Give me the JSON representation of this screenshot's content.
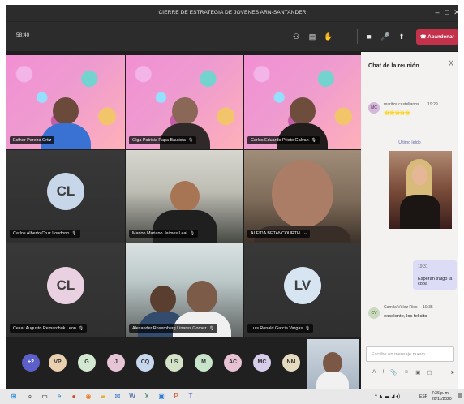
{
  "window": {
    "title": "CIERRE DE ESTRATEGIA DE JOVENES ARN-SANTANDER",
    "minimize": "–",
    "maximize": "□",
    "close": "✕"
  },
  "toolbar": {
    "timer": "58:40",
    "leave_label": "Abandonar",
    "icons": [
      "participants-icon",
      "chat-icon",
      "raise-hand-icon",
      "more-icon",
      "camera-icon",
      "microphone-icon",
      "share-icon",
      "phone-hangup-icon"
    ]
  },
  "grid": {
    "tiles": [
      {
        "name": "Esther Pereira Ortiz",
        "mic": ""
      },
      {
        "name": "Olga Patricia Papa Bautista",
        "mic": "🎙"
      },
      {
        "name": "Carlos Eduardo Prieto Galvan",
        "mic": "🎙"
      },
      {
        "name": "Carlos Alberto Cruz Londono",
        "mic": "🎙",
        "initials": "CL"
      },
      {
        "name": "Marlon Mariano Jaimes Leal",
        "mic": "🎙"
      },
      {
        "name": "ALEIDA BETANCOURTH",
        "mic": "···"
      },
      {
        "name": "Cesar Augusto Remarchuk Leon",
        "mic": "🎙",
        "initials": "CL"
      },
      {
        "name": "Alexander Rosemberg Linares Gomez",
        "mic": "🎙"
      },
      {
        "name": "Luis Ronald Garcia Vargas",
        "mic": "🎙",
        "initials": "LV"
      }
    ]
  },
  "attendees": [
    {
      "initials": "+2",
      "color": "#5b5fc7"
    },
    {
      "initials": "VP",
      "color": "#e9d0b0"
    },
    {
      "initials": "G",
      "color": "#d3e8d0"
    },
    {
      "initials": "J",
      "color": "#e5c5d6"
    },
    {
      "initials": "CQ",
      "color": "#c7d7ee"
    },
    {
      "initials": "LS",
      "color": "#d4e2c8"
    },
    {
      "initials": "M",
      "color": "#c8e5cc"
    },
    {
      "initials": "AC",
      "color": "#e7c2d3"
    },
    {
      "initials": "MC",
      "color": "#d7cdea"
    },
    {
      "initials": "NM",
      "color": "#e5dcc0"
    }
  ],
  "chat": {
    "title": "Chat de la reunión",
    "close": "X",
    "messages": [
      {
        "author": "maritza castellanos",
        "time": "19:29",
        "body": "🌟🌟🌟🌟🌟",
        "initials": "MC"
      }
    ],
    "read_divider": "Último leído",
    "own_message": {
      "time": "19:31",
      "body": "Esperan traigo la copa"
    },
    "reply": {
      "author": "Camila Vélez Rico",
      "time": "19:35",
      "body": "excelente, los felicito",
      "initials": "CV"
    },
    "compose_placeholder": "Escribe un mensaje nuevo",
    "compose_tools": [
      "A",
      "!",
      "📎",
      "☺",
      "▣",
      "▢",
      "···",
      "➤"
    ]
  },
  "taskbar": {
    "apps": [
      "windows-icon",
      "search-icon",
      "task-view-icon",
      "edge-icon",
      "chrome-icon",
      "firefox-icon",
      "folder-icon",
      "mail-icon",
      "word-icon",
      "excel-icon",
      "files-icon",
      "powerpoint-icon",
      "teams-icon"
    ],
    "language": "ESP",
    "time": "7:36 p. m.",
    "date": "20/11/2020"
  }
}
